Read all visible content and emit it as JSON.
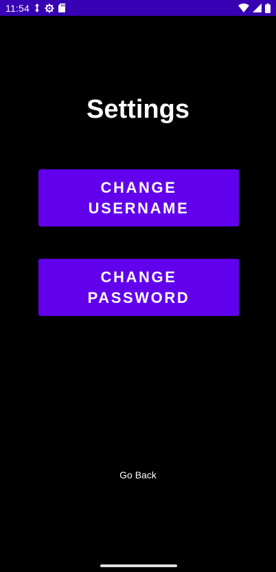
{
  "status_bar": {
    "time": "11:54",
    "icons": [
      "data-saver-icon",
      "settings-gear-icon",
      "sd-card-icon",
      "wifi-icon",
      "signal-icon",
      "battery-icon"
    ],
    "background_color": "#3700b3"
  },
  "screen": {
    "title": "Settings",
    "background_color": "#000000"
  },
  "buttons": {
    "change_username": "CHANGE USERNAME",
    "change_password": "CHANGE PASSWORD",
    "color": "#6200ee"
  },
  "footer": {
    "go_back": "Go Back"
  }
}
